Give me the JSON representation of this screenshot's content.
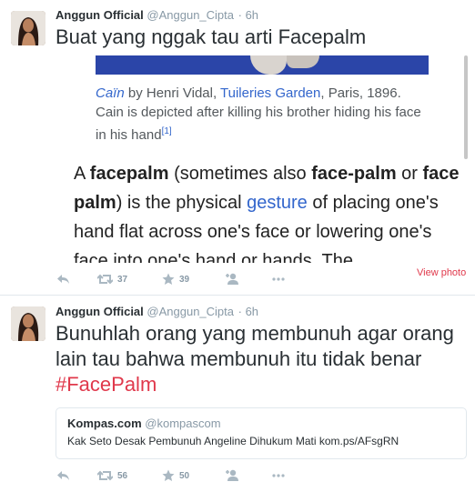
{
  "tweets": [
    {
      "name": "Anggun Official",
      "handle": "@Anggun_Cipta",
      "time": "· 6h",
      "text": "Buat yang nggak tau arti Facepalm",
      "photo": {
        "caption_title": "Caïn",
        "caption_by": " by Henri Vidal, ",
        "caption_place": "Tuileries Garden",
        "caption_rest": ", Paris, 1896. Cain is depicted after killing his brother hiding his face in his hand",
        "caption_ref": "[1]",
        "article": {
          "p1": "A ",
          "b1": "facepalm",
          "p2": " (sometimes also ",
          "b2": "face-palm",
          "p3": " or ",
          "b3": "face palm",
          "p4": ") is the physical ",
          "link": "gesture",
          "p5": " of placing one's hand flat across one's face or lowering one's face into one's hand or hands. The"
        }
      },
      "view_photo": "View photo",
      "retweets": "37",
      "favorites": "39"
    },
    {
      "name": "Anggun Official",
      "handle": "@Anggun_Cipta",
      "time": "· 6h",
      "text": "Bunuhlah orang yang membunuh agar orang lain tau bahwa membunuh itu tidak benar ",
      "hashtag": "#FacePalm",
      "card": {
        "name": "Kompas.com",
        "handle": "@kompascom",
        "text": "Kak Seto Desak Pembunuh Angeline Dihukum Mati  kom.ps/AFsgRN"
      },
      "retweets": "56",
      "favorites": "50"
    }
  ],
  "icons": {
    "reply": "reply-icon",
    "retweet": "retweet-icon",
    "favorite": "star-icon",
    "follow": "add-user-icon"
  },
  "colors": {
    "hashtag": "#e0384b",
    "link": "#3366cc",
    "muted": "#8899a6",
    "text": "#292f33"
  }
}
